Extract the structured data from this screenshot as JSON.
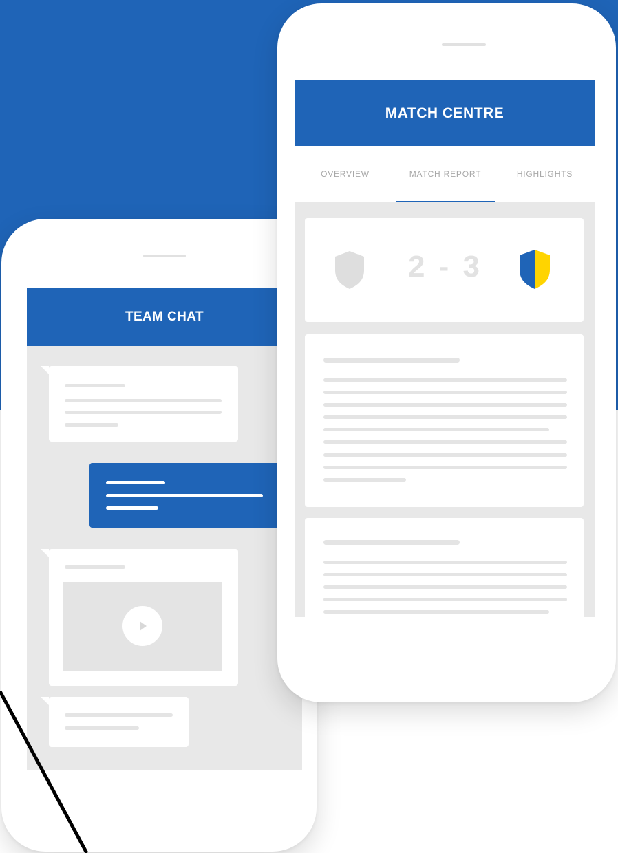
{
  "left_phone": {
    "header": {
      "title": "TEAM CHAT"
    }
  },
  "right_phone": {
    "header": {
      "title": "MATCH CENTRE"
    },
    "tabs": [
      {
        "label": "OVERVIEW"
      },
      {
        "label": "MATCH REPORT",
        "active": true
      },
      {
        "label": "HIGHLIGHTS"
      }
    ],
    "score": {
      "home": "2",
      "separator": "-",
      "away": "3",
      "display": "2 - 3"
    }
  },
  "colors": {
    "brand_blue": "#1f64b7",
    "screen_gray": "#e8e8e8",
    "crest_home": "#dedede",
    "crest_away_left": "#1f64b7",
    "crest_away_right": "#ffd400"
  },
  "icons": [
    "home-team-crest-icon",
    "away-team-crest-icon",
    "play-icon"
  ]
}
